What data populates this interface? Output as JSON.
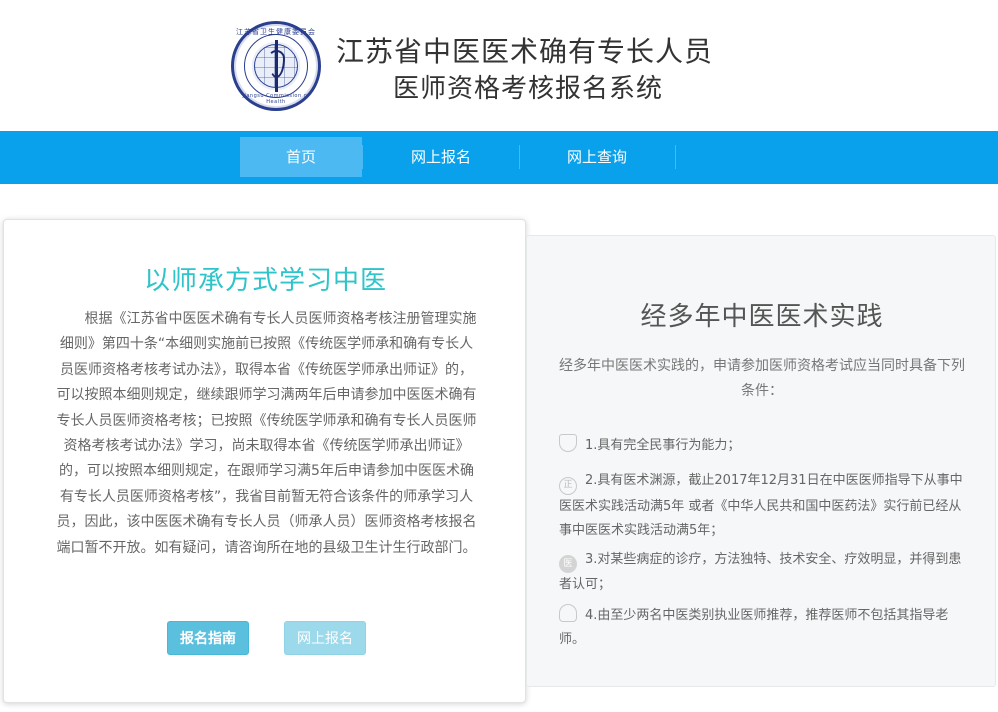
{
  "header": {
    "logo_text_top": "江苏省卫生健康委员会",
    "logo_text_bottom": "Jiangsu Commission of Health",
    "title_line1": "江苏省中医医术确有专长人员",
    "title_line2": "医师资格考核报名系统"
  },
  "nav": {
    "items": [
      {
        "label": "首页",
        "active": true
      },
      {
        "label": "网上报名",
        "active": false
      },
      {
        "label": "网上查询",
        "active": false
      }
    ]
  },
  "left_card": {
    "title": "以师承方式学习中医",
    "body": "根据《江苏省中医医术确有专长人员医师资格考核注册管理实施细则》第四十条“本细则实施前已按照《传统医学师承和确有专长人员医师资格考核考试办法》，取得本省《传统医学师承出师证》的，可以按照本细则规定，继续跟师学习满两年后申请参加中医医术确有专长人员医师资格考核；已按照《传统医学师承和确有专长人员医师资格考核考试办法》学习，尚未取得本省《传统医学师承出师证》的，可以按照本细则规定，在跟师学习满5年后申请参加中医医术确有专长人员医师资格考核”，我省目前暂无符合该条件的师承学习人员，因此，该中医医术确有专长人员（师承人员）医师资格考核报名端口暂不开放。如有疑问，请咨询所在地的县级卫生计生行政部门。",
    "guide_button": "报名指南",
    "apply_button": "网上报名"
  },
  "right_card": {
    "title": "经多年中医医术实践",
    "intro": "经多年中医医术实践的，申请参加医师资格考试应当同时具备下列条件：",
    "conditions": [
      {
        "icon": "shield-icon",
        "text": "1.具有完全民事行为能力；"
      },
      {
        "icon": "certificate-icon",
        "text": "2.具有医术渊源，截止2017年12月31日在中医医师指导下从事中医医术实践活动满5年 或者《中华人民共和国中医药法》实行前已经从事中医医术实践活动满5年；"
      },
      {
        "icon": "medical-icon",
        "text": "3.对某些病症的诊疗，方法独特、技术安全、疗效明显，并得到患者认可；"
      },
      {
        "icon": "people-icon",
        "text": "4.由至少两名中医类别执业医师推荐，推荐医师不包括其指导老师。"
      }
    ]
  }
}
